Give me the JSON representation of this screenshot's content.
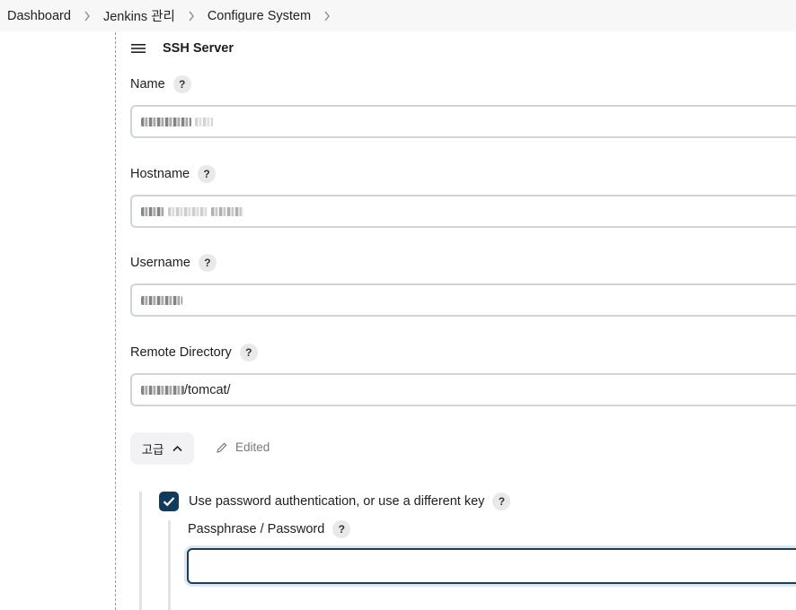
{
  "breadcrumb": {
    "items": [
      "Dashboard",
      "Jenkins 관리",
      "Configure System"
    ]
  },
  "section": {
    "title": "SSH Server"
  },
  "fields": {
    "name": {
      "label": "Name",
      "help": "?"
    },
    "hostname": {
      "label": "Hostname",
      "help": "?"
    },
    "username": {
      "label": "Username",
      "help": "?"
    },
    "remote_directory": {
      "label": "Remote Directory",
      "help": "?",
      "visible_suffix": "/tomcat/"
    }
  },
  "advanced": {
    "button_label": "고급",
    "edited_label": "Edited"
  },
  "auth": {
    "checkbox_label": "Use password authentication, or use a different key",
    "checked": true,
    "help": "?",
    "passphrase_label": "Passphrase / Password",
    "passphrase_help": "?",
    "passphrase_value": ""
  },
  "colors": {
    "accent": "#123a5b",
    "breadcrumb_bg": "#f7f7f8",
    "input_border": "#cfd4d9"
  }
}
